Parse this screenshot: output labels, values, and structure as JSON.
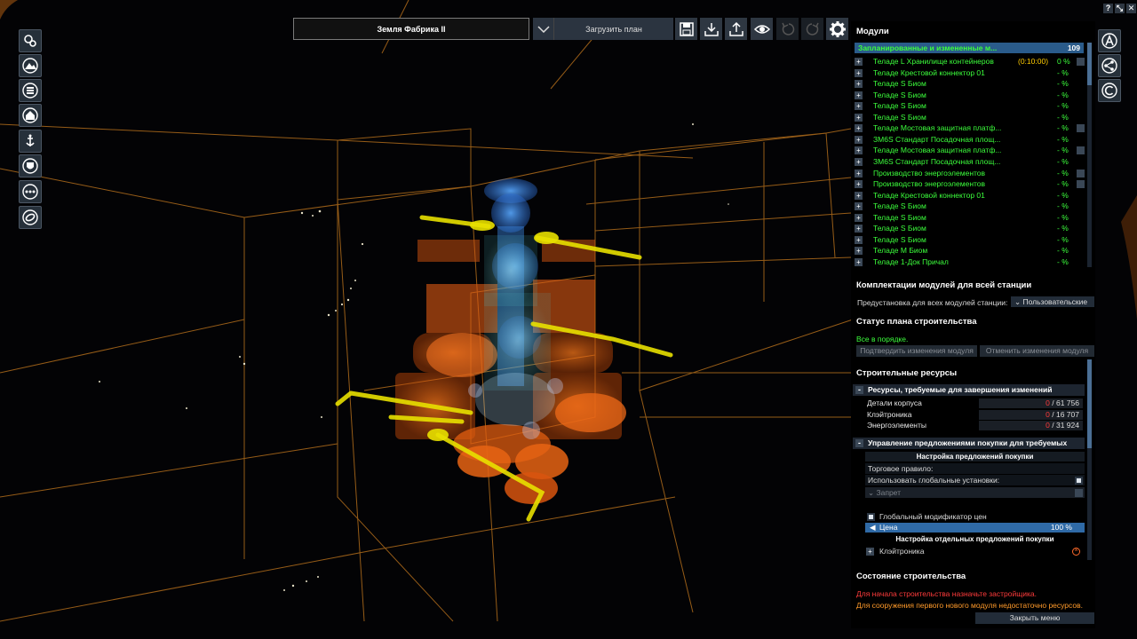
{
  "topbar": {
    "plan_name": "Земля Фабрика II",
    "load_plan": "Загрузить план"
  },
  "window_buttons": [
    "?",
    "⤡",
    "✕"
  ],
  "left_toolbar": [
    "gear-cluster-icon",
    "mountain-icon",
    "database-icon",
    "home-icon",
    "anchor-icon",
    "shield-icon",
    "more-icon",
    "ring-icon"
  ],
  "right_buttons": [
    "A",
    "share",
    "C"
  ],
  "panel": {
    "modules_title": "Модули",
    "modules_header": "Запланированные и измененные м...",
    "modules_count": "109",
    "modules": [
      {
        "name": "Теладе L Хранилище контейнеров",
        "time": "(0:10:00)",
        "pct": "0 %",
        "edit": true
      },
      {
        "name": "Теладе Крестовой коннектор 01",
        "pct": "- %"
      },
      {
        "name": "Теладе S Биом",
        "pct": "- %"
      },
      {
        "name": "Теладе S Биом",
        "pct": "- %"
      },
      {
        "name": "Теладе S Биом",
        "pct": "- %"
      },
      {
        "name": "Теладе S Биом",
        "pct": "- %"
      },
      {
        "name": "Теладе Мостовая защитная платф...",
        "pct": "- %",
        "edit": true
      },
      {
        "name": "ЗМ6S Стандарт Посадочная площ...",
        "pct": "- %"
      },
      {
        "name": "Теладе Мостовая защитная платф...",
        "pct": "- %",
        "edit": true
      },
      {
        "name": "ЗМ6S Стандарт Посадочная площ...",
        "pct": "- %"
      },
      {
        "name": "Производство энергоэлементов",
        "pct": "- %",
        "edit": true
      },
      {
        "name": "Производство энергоэлементов",
        "pct": "- %",
        "edit": true
      },
      {
        "name": "Теладе Крестовой коннектор 01",
        "pct": "- %"
      },
      {
        "name": "Теладе S Биом",
        "pct": "- %"
      },
      {
        "name": "Теладе S Биом",
        "pct": "- %"
      },
      {
        "name": "Теладе S Биом",
        "pct": "- %"
      },
      {
        "name": "Теладе S Биом",
        "pct": "- %"
      },
      {
        "name": "Теладе М Биом",
        "pct": "- %"
      },
      {
        "name": "Теладе 1-Док Причал",
        "pct": "- %"
      }
    ],
    "loadout_title": "Комплектации модулей для всей станции",
    "preset_label": "Предустановка для всех модулей станции:",
    "preset_value": "Пользовательские",
    "status_title": "Статус плана строительства",
    "status_ok": "Все в порядке.",
    "confirm_btn": "Подтвердить изменения модуля",
    "cancel_btn": "Отменить изменения модуля",
    "resources_title": "Строительные ресурсы",
    "req_title": "Ресурсы, требуемые для завершения изменений",
    "resources": [
      {
        "name": "Детали корпуса",
        "have": "0",
        "need": "/ 61 756"
      },
      {
        "name": "Клэйтроника",
        "have": "0",
        "need": "/ 16 707"
      },
      {
        "name": "Энергоэлементы",
        "have": "0",
        "need": "/ 31 924"
      }
    ],
    "buy_title": "Управление предложениями покупки для требуемых ресур...",
    "buy_settings": "Настройка предложений покупки",
    "trade_rule": "Торговое правило:",
    "use_global": "Использовать глобальные установки:",
    "forbid": "Запрет",
    "global_mod": "Глобальный модификатор цен",
    "price_label": "Цена",
    "price_value": "100 %",
    "individual": "Настройка отдельных предложений покупки",
    "claytronics": "Клэйтроника",
    "construction_title": "Состояние строительства",
    "msg_builder": "Для начала строительства назначьте застройщика.",
    "msg_resources": "Для сооружения первого нового модуля недостаточно ресурсов.",
    "close_menu": "Закрыть меню"
  },
  "colors": {
    "accent": "#2f6aa6",
    "green": "#3cff3c",
    "red": "#ff3b3b",
    "orange": "#ff9a2a",
    "grid": "#c77a1e"
  }
}
